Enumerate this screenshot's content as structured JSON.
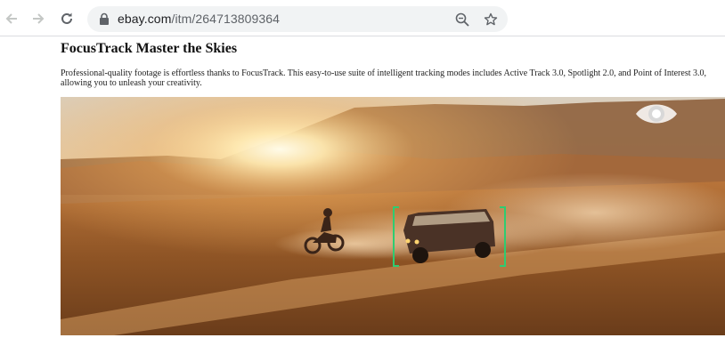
{
  "browser": {
    "url_host": "ebay.com",
    "url_path": "/itm/264713809364",
    "icons": {
      "back": "arrow-left-icon",
      "forward": "arrow-right-icon",
      "reload": "reload-icon",
      "lock": "lock-icon",
      "zoom": "zoom-out-icon",
      "bookmark": "star-icon"
    }
  },
  "page": {
    "title": "FocusTrack Master the Skies",
    "description": "Professional-quality footage is effortless thanks to FocusTrack. This easy-to-use suite of intelligent tracking modes includes Active Track 3.0, Spotlight 2.0, and Point of Interest 3.0, allowing you to unleash your creativity."
  },
  "hero": {
    "image": "desert-van-tracking-photo",
    "overlay_icon": "eye-icon",
    "tracking_box_color": "#2ecc71"
  }
}
